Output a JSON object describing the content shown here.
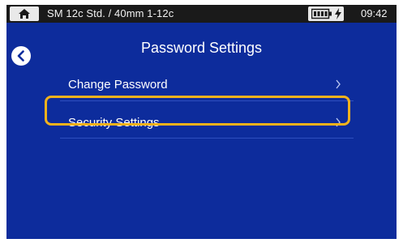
{
  "status_bar": {
    "mode": "SM 12c Std. / 40mm 1-12c",
    "time": "09:42",
    "home_icon": "home-icon",
    "battery_icon": "battery-full-icon",
    "charging_icon": "charging-bolt-icon"
  },
  "header": {
    "title": "Password Settings",
    "back_icon": "chevron-left-icon"
  },
  "menu": {
    "items": [
      {
        "label": "Change Password",
        "icon": "chevron-right-icon"
      },
      {
        "label": "Security Settings",
        "icon": "chevron-right-icon",
        "highlighted": true
      }
    ]
  },
  "colors": {
    "background": "#0d2c9c",
    "status_bar": "#1a1a1a",
    "highlight": "#f3b21c",
    "text": "#ffffff"
  }
}
